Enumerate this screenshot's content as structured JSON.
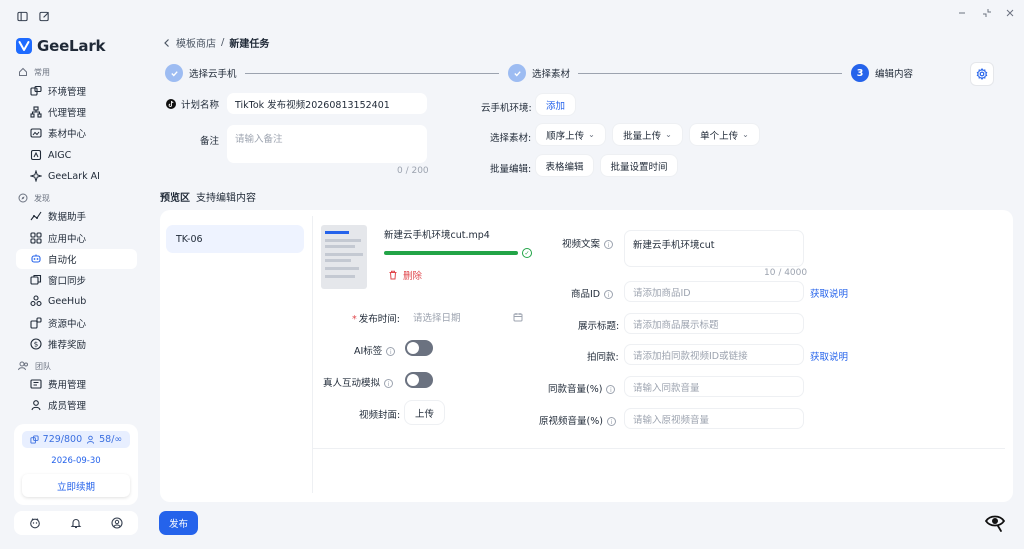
{
  "app": {
    "name": "GeeLark"
  },
  "sidebar": {
    "sections": {
      "common": "常用",
      "discover": "发现",
      "team": "团队"
    },
    "items": [
      {
        "label": "环境管理",
        "icon": "profile-manage-icon"
      },
      {
        "label": "代理管理",
        "icon": "proxy-icon"
      },
      {
        "label": "素材中心",
        "icon": "media-center-icon"
      },
      {
        "label": "AIGC",
        "icon": "aigc-icon"
      },
      {
        "label": "GeeLark AI",
        "icon": "ai-icon"
      },
      {
        "label": "数据助手",
        "icon": "data-assistant-icon"
      },
      {
        "label": "应用中心",
        "icon": "app-center-icon"
      },
      {
        "label": "自动化",
        "icon": "automation-icon",
        "active": true
      },
      {
        "label": "窗口同步",
        "icon": "window-sync-icon"
      },
      {
        "label": "GeeHub",
        "icon": "geehub-icon"
      },
      {
        "label": "资源中心",
        "icon": "resource-center-icon"
      },
      {
        "label": "推荐奖励",
        "icon": "referral-reward-icon"
      },
      {
        "label": "费用管理",
        "icon": "billing-icon"
      },
      {
        "label": "成员管理",
        "icon": "member-icon"
      }
    ],
    "quota": {
      "profiles": "729/800",
      "members": "58/∞",
      "expiry": "2026-09-30",
      "renew_label": "立即续期"
    }
  },
  "breadcrumb": {
    "parent": "模板商店",
    "separator": "/",
    "current": "新建任务"
  },
  "steps": [
    {
      "label": "选择云手机",
      "state": "done"
    },
    {
      "label": "选择素材",
      "state": "done"
    },
    {
      "number": "3",
      "label": "编辑内容",
      "state": "active"
    }
  ],
  "form": {
    "plan_name_label": "计划名称",
    "plan_name_value": "TikTok 发布视频20260813152401",
    "remark_label": "备注",
    "remark_placeholder": "请输入备注",
    "remark_counter": "0 / 200",
    "cloud_env_label": "云手机环境:",
    "add_label": "添加",
    "select_material_label": "选择素材:",
    "upload_sequential": "顺序上传",
    "upload_batch": "批量上传",
    "upload_single": "单个上传",
    "batch_edit_label": "批量编辑:",
    "table_edit": "表格编辑",
    "batch_set_time": "批量设置时间"
  },
  "preview": {
    "title": "预览区",
    "subtitle": "支持编辑内容",
    "device": "TK-06",
    "file_name": "新建云手机环境cut.mp4",
    "upload_progress": 1.0,
    "delete_label": "删除",
    "publish_time_label": "发布时间:",
    "publish_time_placeholder": "请选择日期",
    "ai_label_label": "AI标签",
    "ai_label_on": false,
    "real_interaction_label": "真人互动模拟",
    "real_interaction_on": false,
    "cover_label": "视频封面:",
    "cover_upload": "上传",
    "caption_label": "视频文案",
    "caption_value": "新建云手机环境cut",
    "caption_counter": "10 / 4000",
    "product_id_label": "商品ID",
    "product_id_placeholder": "请添加商品ID",
    "get_help": "获取说明",
    "display_title_label": "展示标题:",
    "display_title_placeholder": "请添加商品展示标题",
    "same_style_label": "拍同款:",
    "same_style_placeholder": "请添加拍同款视频ID或链接",
    "same_volume_label": "同款音量(%)",
    "same_volume_placeholder": "请输入同款音量",
    "orig_volume_label": "原视频音量(%)",
    "orig_volume_placeholder": "请输入原视频音量"
  },
  "footer": {
    "publish": "发布"
  },
  "colors": {
    "accent": "#2563eb",
    "success": "#22a447",
    "danger": "#e0464b"
  }
}
